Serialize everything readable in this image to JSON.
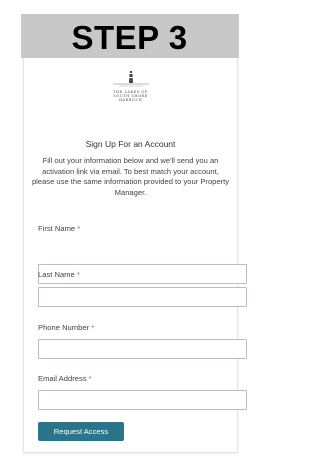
{
  "banner": {
    "title": "STEP 3"
  },
  "logo": {
    "line1": "THE LAKES OF",
    "line2": "SOUTH SHORE",
    "line3": "HARBOUR"
  },
  "form": {
    "heading": "Sign Up For an Account",
    "intro": "Fill out your information below and we'll send you an activation link via email. To best match your account, please use the same information provided to your Property Manager.",
    "required_marker": "*",
    "fields": [
      {
        "label": "First Name",
        "value": ""
      },
      {
        "label": "Last Name",
        "value": ""
      },
      {
        "label": "Phone Number",
        "value": ""
      },
      {
        "label": "Email Address",
        "value": ""
      }
    ],
    "submit_label": "Request Access"
  },
  "colors": {
    "accent": "#2b7489",
    "required": "#d9534f",
    "banner": "#c8c8c8"
  }
}
